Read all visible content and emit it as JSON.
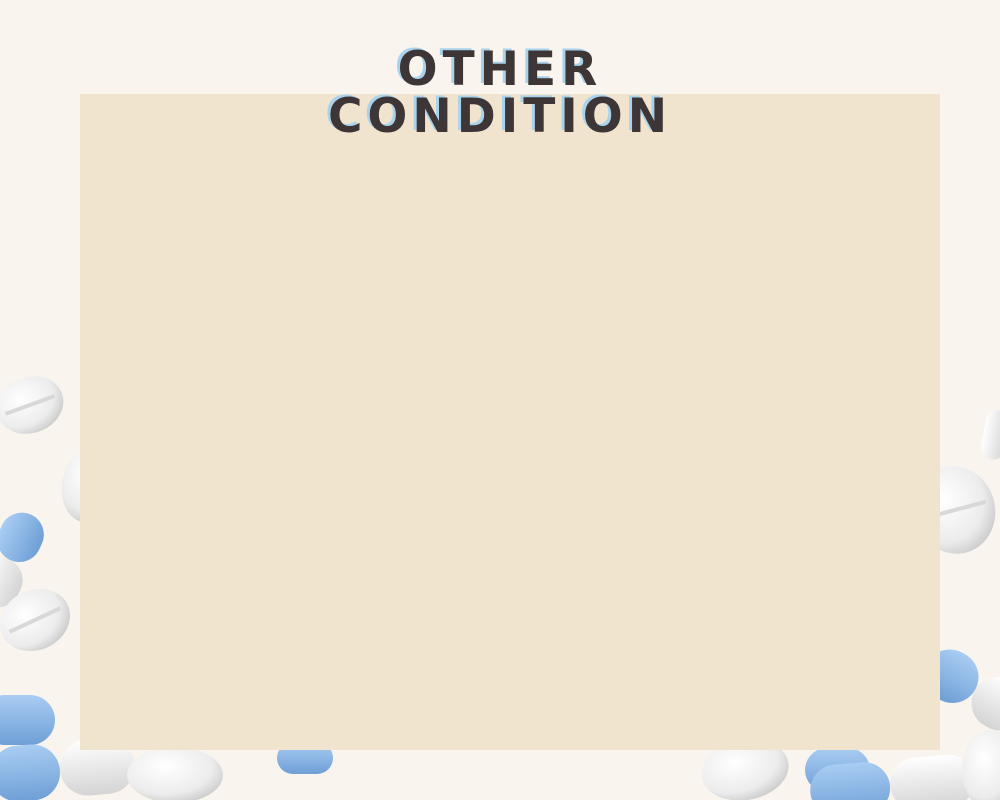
{
  "title": {
    "line1": "OTHER",
    "line2": "CONDITION"
  },
  "colors": {
    "background": "#f9f5ee",
    "panel": "#f1e4cf",
    "title_text": "#3d3536",
    "title_shadow": "#a9d3ec",
    "capsule_blue": "#8db7e6",
    "pill_white": "#f3f3f3"
  },
  "decor": {
    "description_icons": [
      "pill-icon",
      "capsule-icon"
    ]
  }
}
